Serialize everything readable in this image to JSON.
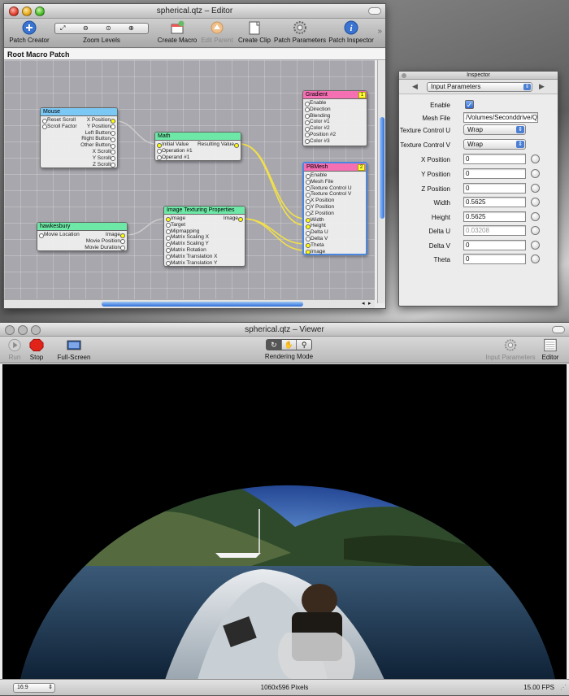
{
  "editor": {
    "title": "spherical.qtz – Editor",
    "toolbar": {
      "patch_creator": "Patch Creator",
      "zoom_levels": "Zoom Levels",
      "create_macro": "Create Macro",
      "edit_parent": "Edit Parent",
      "create_clip": "Create Clip",
      "patch_parameters": "Patch Parameters",
      "patch_inspector": "Patch Inspector",
      "overflow": "»"
    },
    "breadcrumb": "Root Macro Patch",
    "patches": {
      "mouse": {
        "title": "Mouse",
        "inputs": [
          "Reset Scroll",
          "Scroll Factor"
        ],
        "outputs": [
          "X Position",
          "Y Position",
          "Left Button",
          "Right Button",
          "Other Button",
          "X Scroll",
          "Y Scroll",
          "Z Scroll"
        ]
      },
      "math": {
        "title": "Math",
        "inputs": [
          "Initial Value",
          "Operation #1",
          "Operand #1"
        ],
        "outputs": [
          "Resulting Value"
        ]
      },
      "gradient": {
        "title": "Gradient",
        "badge": "1",
        "inputs": [
          "Enable",
          "Direction",
          "Blending",
          "Color #1",
          "Color #2",
          "Position #2",
          "Color #3"
        ]
      },
      "pbmesh": {
        "title": "PBMesh",
        "badge": "2",
        "inputs": [
          "Enable",
          "Mesh File",
          "Texture Control U",
          "Texture Control V",
          "X Position",
          "Y Position",
          "Z Position",
          "Width",
          "Height",
          "Delta U",
          "Delta V",
          "Theta",
          "Image"
        ]
      },
      "hawkesbury": {
        "title": "hawkesbury",
        "inputs": [
          "Movie Location"
        ],
        "outputs": [
          "Image",
          "Movie Position",
          "Movie Duration"
        ]
      },
      "texturing": {
        "title": "Image Texturing Properties",
        "inputs": [
          "Image",
          "Target",
          "Mipmapping",
          "Matrix Scaling X",
          "Matrix Scaling Y",
          "Matrix Rotation",
          "Matrix Translation X",
          "Matrix Translation Y"
        ],
        "outputs": [
          "Image"
        ]
      }
    }
  },
  "inspector": {
    "title": "Inspector",
    "section": "Input Parameters",
    "rows": [
      {
        "label": "Enable",
        "type": "checkbox",
        "value": "✓"
      },
      {
        "label": "Mesh File",
        "type": "text",
        "value": "/Volumes/Seconddrive/Q"
      },
      {
        "label": "Texture Control U",
        "type": "select",
        "value": "Wrap"
      },
      {
        "label": "Texture Control V",
        "type": "select",
        "value": "Wrap"
      },
      {
        "label": "X Position",
        "type": "number",
        "value": "0"
      },
      {
        "label": "Y Position",
        "type": "number",
        "value": "0"
      },
      {
        "label": "Z Position",
        "type": "number",
        "value": "0"
      },
      {
        "label": "Width",
        "type": "number",
        "value": "0.5625"
      },
      {
        "label": "Height",
        "type": "number",
        "value": "0.5625"
      },
      {
        "label": "Delta U",
        "type": "number",
        "value": "0.03208",
        "disabled": true
      },
      {
        "label": "Delta V",
        "type": "number",
        "value": "0"
      },
      {
        "label": "Theta",
        "type": "number",
        "value": "0"
      }
    ]
  },
  "viewer": {
    "title": "spherical.qtz – Viewer",
    "toolbar": {
      "run": "Run",
      "stop": "Stop",
      "fullscreen": "Full-Screen",
      "rendering_mode": "Rendering Mode",
      "input_parameters": "Input Parameters",
      "editor": "Editor"
    },
    "status": {
      "aspect": "16:9",
      "pixels": "1060x596 Pixels",
      "fps": "15.00 FPS"
    }
  },
  "colors": {
    "mouse_header": "#7cc8f5",
    "math_header": "#6ee8a6",
    "gradient_header": "#f56fb3",
    "pbmesh_header": "#f56fb3",
    "movie_header": "#6ee8a6",
    "texturing_header": "#6ee8a6",
    "connection": "#f2e04a",
    "selection": "#4a87e0"
  }
}
